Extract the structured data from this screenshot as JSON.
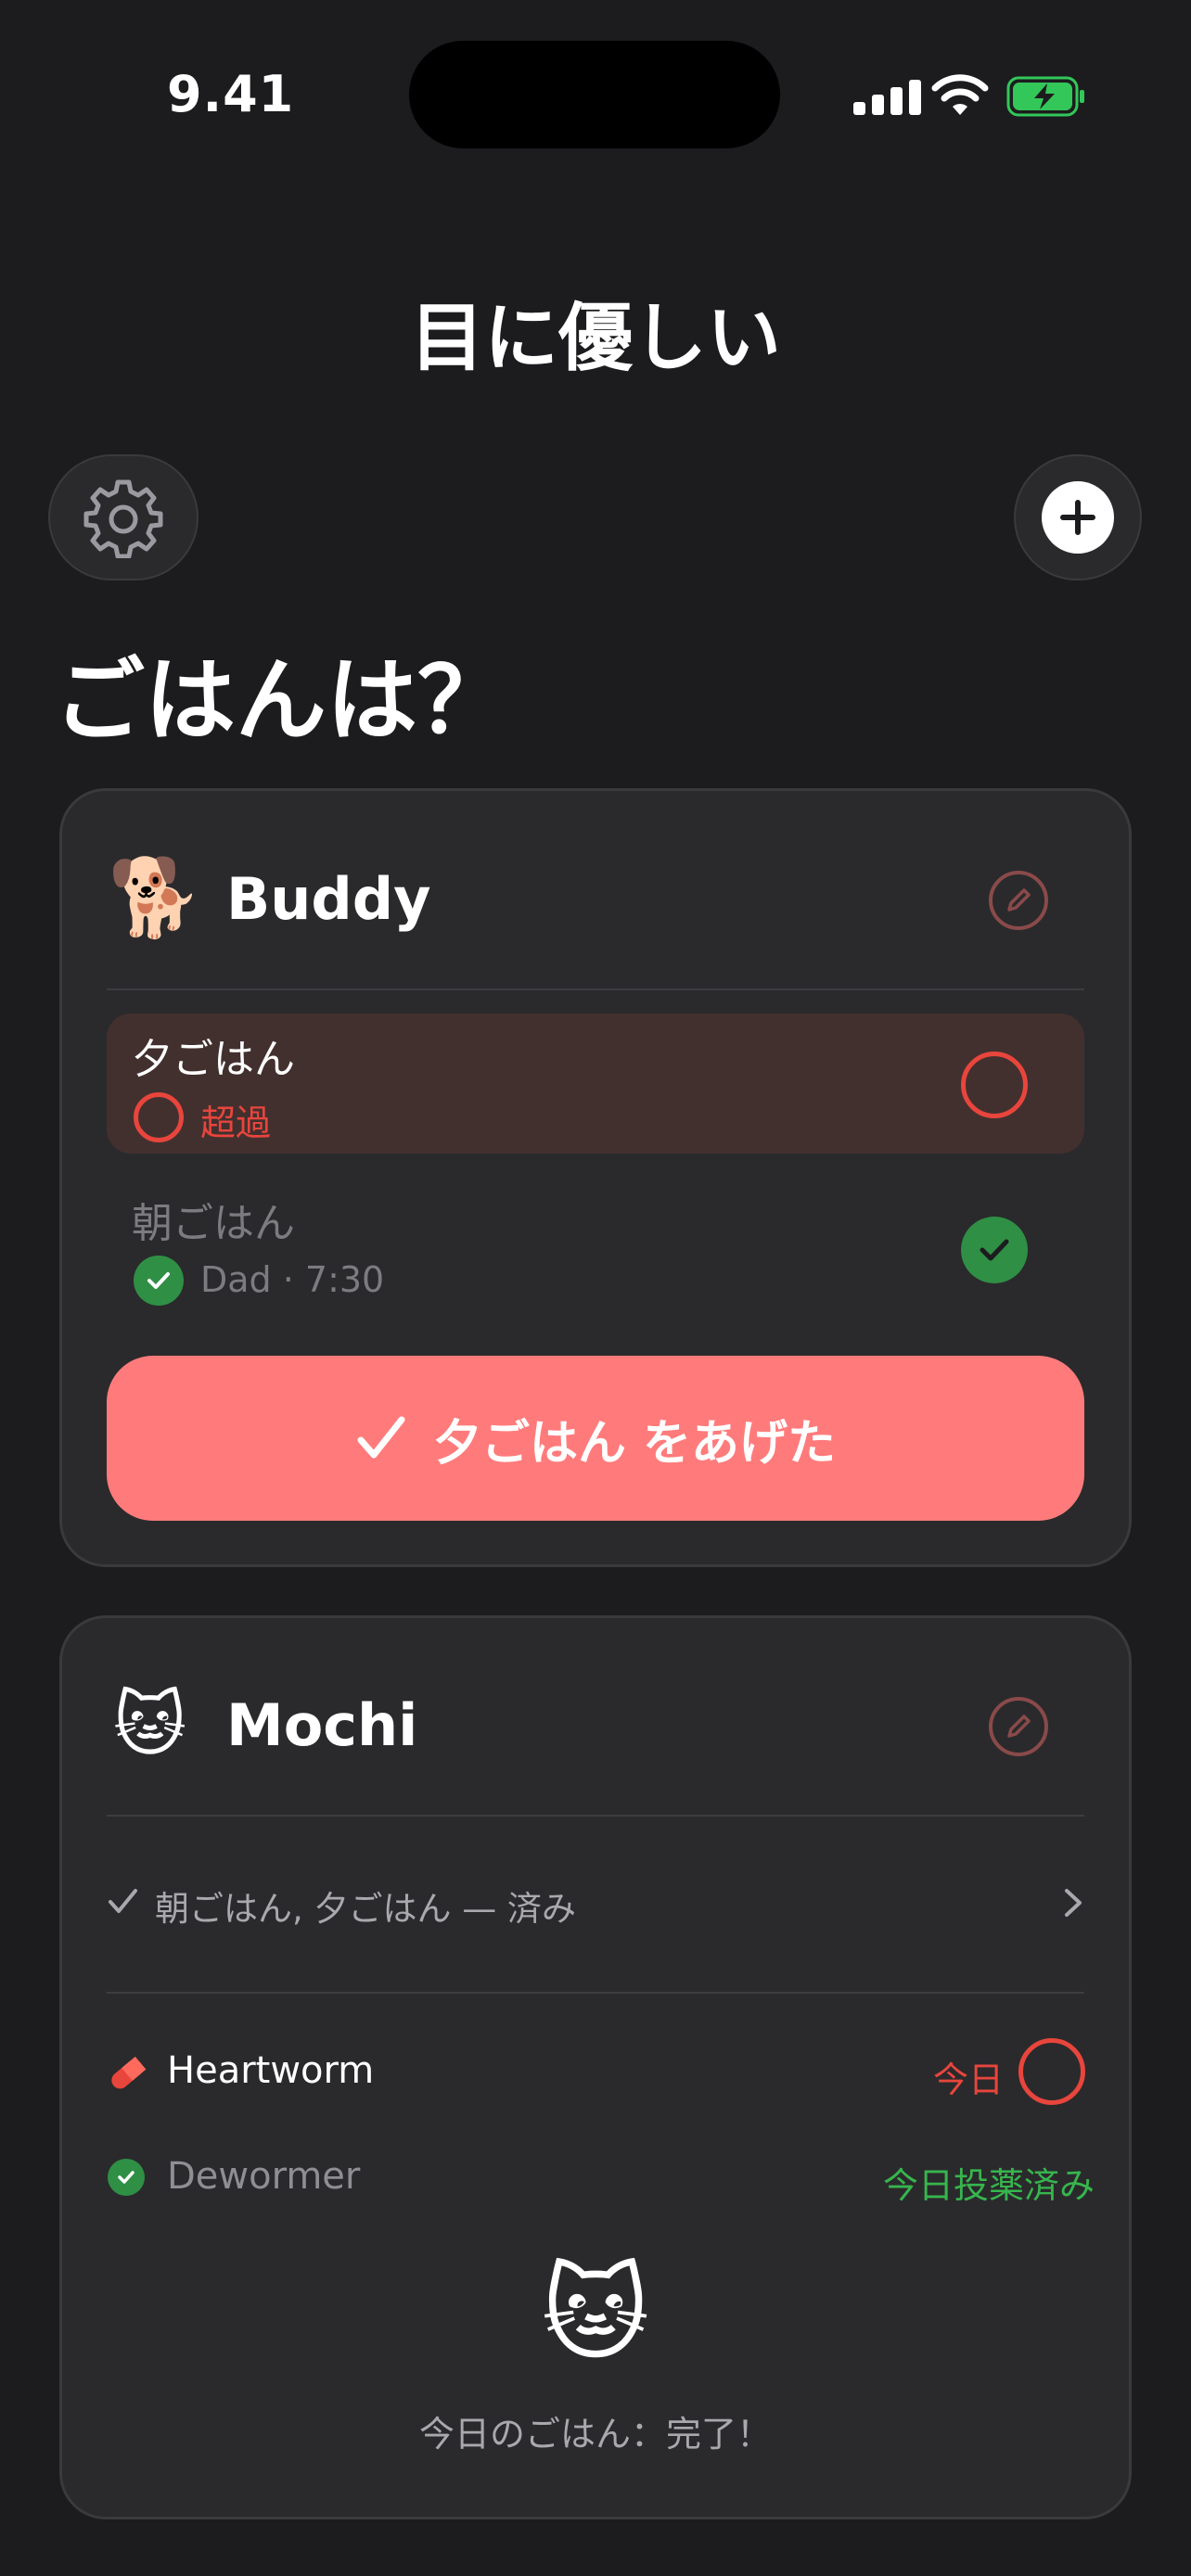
{
  "status_bar": {
    "time": "9.41"
  },
  "header": {
    "app_title": "目に優しい"
  },
  "page_heading": "ごはんは？",
  "pets": [
    {
      "emoji": "🐕",
      "name": "Buddy",
      "meals": [
        {
          "label": "夕ごはん",
          "status": "超過",
          "state": "overdue"
        },
        {
          "label": "朝ごはん",
          "status": "Dad · 7:30",
          "state": "done"
        }
      ],
      "action_button": "夕ごはん をあげた"
    },
    {
      "emoji": "🐱",
      "name": "Mochi",
      "summary": "朝ごはん, 夕ごはん — 済み",
      "medications": [
        {
          "name": "Heartworm",
          "status": "今日",
          "state": "due"
        },
        {
          "name": "Dewormer",
          "status": "今日投薬済み",
          "state": "done"
        }
      ],
      "completion_emoji": "🐱",
      "completion_text": "今日のごはん：完了！"
    }
  ],
  "colors": {
    "background": "#1c1c1e",
    "card": "#2a2a2c",
    "accent_red": "#e8453c",
    "button": "#ff7b7b",
    "success_green": "#2f8f45"
  }
}
